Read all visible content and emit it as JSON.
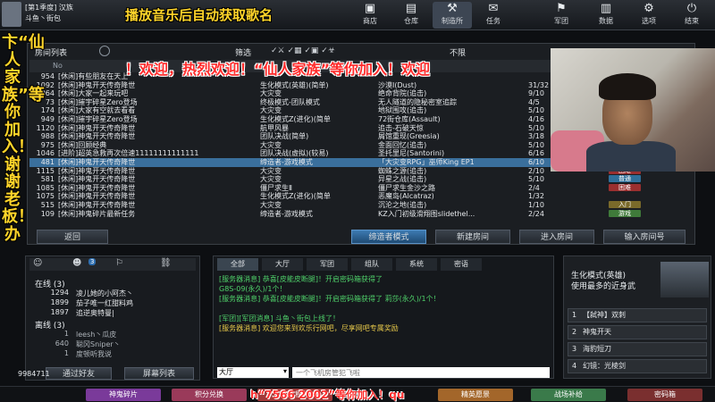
{
  "top": {
    "headline": "播放音乐后自动获取歌名",
    "user_line1": "[第1季度] 汉族",
    "user_line2": "斗鱼丶街包",
    "nav": [
      {
        "label": "商店",
        "icon": "shop-icon"
      },
      {
        "label": "仓库",
        "icon": "warehouse-icon"
      },
      {
        "label": "制造所",
        "icon": "factory-icon"
      },
      {
        "label": "任务",
        "icon": "task-icon"
      },
      {
        "label": "军团",
        "icon": "clan-icon"
      },
      {
        "label": "数据",
        "icon": "data-icon"
      },
      {
        "label": "选项",
        "icon": "gear-icon"
      },
      {
        "label": "结束",
        "icon": "power-icon"
      }
    ]
  },
  "overlay": {
    "vertical": "卞“仙人家族”等你加入！谢谢老板！办",
    "banner": "！欢迎，热烈欢迎！“仙人家族”等你加入！欢迎",
    "bottom": "h“7566 2002”等你加入！qu"
  },
  "room_list": {
    "title": "房间列表",
    "filter_label": "筛选",
    "full_label": "不限",
    "columns": {
      "no": "No",
      "name": "房间名",
      "mode": "模式",
      "map": "地图",
      "count": "人数"
    },
    "rows": [
      {
        "no": "954",
        "name": "[休闲]有些朋友在天上",
        "mode": "",
        "map": "",
        "count": "",
        "tag": ""
      },
      {
        "no": "1092",
        "name": "[休闲]神鬼开天传奇降世",
        "mode": "生化模式(英雄)(简单)",
        "map": "沙漠Ⅰ(Dust)",
        "count": "31/32",
        "tag": ""
      },
      {
        "no": "964",
        "name": "[休闲]大家一起来玩吧",
        "mode": "大灾变",
        "map": "绝命背院(追击)",
        "count": "9/10",
        "tag": ""
      },
      {
        "no": "73",
        "name": "[休闲]摧宇碎星Zero登场",
        "mode": "终极模式-团队模式",
        "map": "无人隧道的隐秘密室追踪",
        "count": "4/5",
        "tag": ""
      },
      {
        "no": "174",
        "name": "[休闲]大家有空就去看看",
        "mode": "大灾变",
        "map": "地狱围攻(追击)",
        "count": "5/10",
        "tag": ""
      },
      {
        "no": "949",
        "name": "[休闲]摧宇碎星Zero登场",
        "mode": "生化模式Z(进化)(简单",
        "map": "72街仓库(Assault)",
        "count": "4/16",
        "tag": ""
      },
      {
        "no": "1120",
        "name": "[休闲]神鬼开天传奇降世",
        "mode": "航甲风暴",
        "map": "追击-石破天惊",
        "count": "5/10",
        "tag": ""
      },
      {
        "no": "988",
        "name": "[休闲]神鬼开天传奇降世",
        "mode": "团队决战(简单)",
        "map": "屑馆重现(Greesia)",
        "count": "3/18",
        "tag": ""
      },
      {
        "no": "975",
        "name": "[休闲]回顾经典",
        "mode": "大灾变",
        "map": "金面回忆(追击)",
        "count": "5/10",
        "tag": ""
      },
      {
        "no": "1046",
        "name": "[进阶]超英急救再次倍速11111111111111",
        "mode": "团队决战(虚拟)(较易)",
        "map": "圣托里尼(Santorini)",
        "count": "6/16",
        "tag": ""
      },
      {
        "no": "481",
        "name": "[休闲]神鬼开天传奇降世",
        "mode": "缔造者-游戏模式",
        "map": "「大灾变RPG」巫师King EP1",
        "count": "6/10",
        "tag": "游戏"
      },
      {
        "no": "1115",
        "name": "[休闲]神鬼开天传奇降世",
        "mode": "大灾变",
        "map": "蜘蛛之源(追击)",
        "count": "2/10",
        "tag": "困难"
      },
      {
        "no": "581",
        "name": "[休闲]神鬼开天传奇降世",
        "mode": "大灾变",
        "map": "异星之战(追击)",
        "count": "5/10",
        "tag": "普通"
      },
      {
        "no": "1085",
        "name": "[休闲]神鬼开天传奇降世",
        "mode": "僵尸求生Ⅱ",
        "map": "僵尸求生金沙之路",
        "count": "2/4",
        "tag": "困难"
      },
      {
        "no": "1075",
        "name": "[休闲]神鬼开天传奇降世",
        "mode": "生化模式Z(进化)(简单",
        "map": "恶魔岛(Alcatraz)",
        "count": "1/32",
        "tag": ""
      },
      {
        "no": "515",
        "name": "[休闲]神鬼开天传奇降世",
        "mode": "大灾变",
        "map": "沉沦之地(追击)",
        "count": "1/10",
        "tag": "入门"
      },
      {
        "no": "109",
        "name": "[休闲]神鬼碎片最新任务",
        "mode": "缔造者-游戏模式",
        "map": "KZ入门初级滑翔图slidethel...",
        "count": "2/24",
        "tag": "游戏"
      }
    ],
    "tag_colors": {
      "游戏": "#3f7a3a",
      "困难": "#9a2f2f",
      "普通": "#2f6f9a",
      "入门": "#7a6a2a"
    },
    "back": "返回",
    "buttons": [
      "缔造者模式",
      "新建房间",
      "进入房间",
      "输入房间号"
    ]
  },
  "left": {
    "tabs_count": "3",
    "online_label": "在线 (3)",
    "offline_label": "离线 (3)",
    "friends": [
      {
        "id": "1294",
        "name": "凌儿她的小阿杰丶"
      },
      {
        "id": "1899",
        "name": "茄子唯一红甜料鸡"
      },
      {
        "id": "1897",
        "name": "追逆奥特曼|"
      }
    ],
    "offline": [
      {
        "id": "1",
        "name": "leesh丶瓜皮"
      },
      {
        "id": "640",
        "name": "聪冈Sniper丶"
      },
      {
        "id": "1",
        "name": "度顿听我说"
      }
    ],
    "add_friend": "通过好友",
    "block_list": "屏幕列表",
    "money": "9984711",
    "help": "帮助"
  },
  "chat": {
    "tabs": [
      "全部",
      "大厅",
      "军团",
      "组队",
      "系统",
      "密语"
    ],
    "lines": [
      {
        "text": "[服务器消息] 恭喜[皮能皮断腿]！开启密码箱获得了",
        "cls": "green"
      },
      {
        "text": "G8S-09(永久)/1个！",
        "cls": "green"
      },
      {
        "text": "[服务器消息] 恭喜[皮能皮断腿]！开启密码箱获得了 莉莎(永久)/1个！",
        "cls": "green"
      },
      {
        "text": "",
        "cls": ""
      },
      {
        "text": "[军团][军团消息] 斗鱼丶街包上线了！",
        "cls": "green"
      },
      {
        "text": "[服务器消息] 欢迎您来到欢乐行网吧，尽享网吧专属奖励",
        "cls": "yellow"
      }
    ],
    "channel": "大厅",
    "input_placeholder": "一个飞机房管犯飞啦"
  },
  "right": {
    "mode_title": "生化模式(英雄)",
    "mode_desc": "使用最多的近身武",
    "items": [
      {
        "num": "1",
        "name": "【弑神】双刺"
      },
      {
        "num": "2",
        "name": "神鬼开天"
      },
      {
        "num": "3",
        "name": "海豹短刀"
      },
      {
        "num": "4",
        "name": "幻镜：光棱剑"
      }
    ]
  },
  "bottom": {
    "buttons": [
      "神鬼碎片",
      "积分兑换",
      "好友积分",
      "精英愿景",
      "战场补给",
      "密码箱"
    ],
    "colors": [
      "#7a3a9a",
      "#9a3a5a",
      "#a33a3a",
      "#a3662a",
      "#3a7a4a",
      "#7a2f2f"
    ]
  }
}
